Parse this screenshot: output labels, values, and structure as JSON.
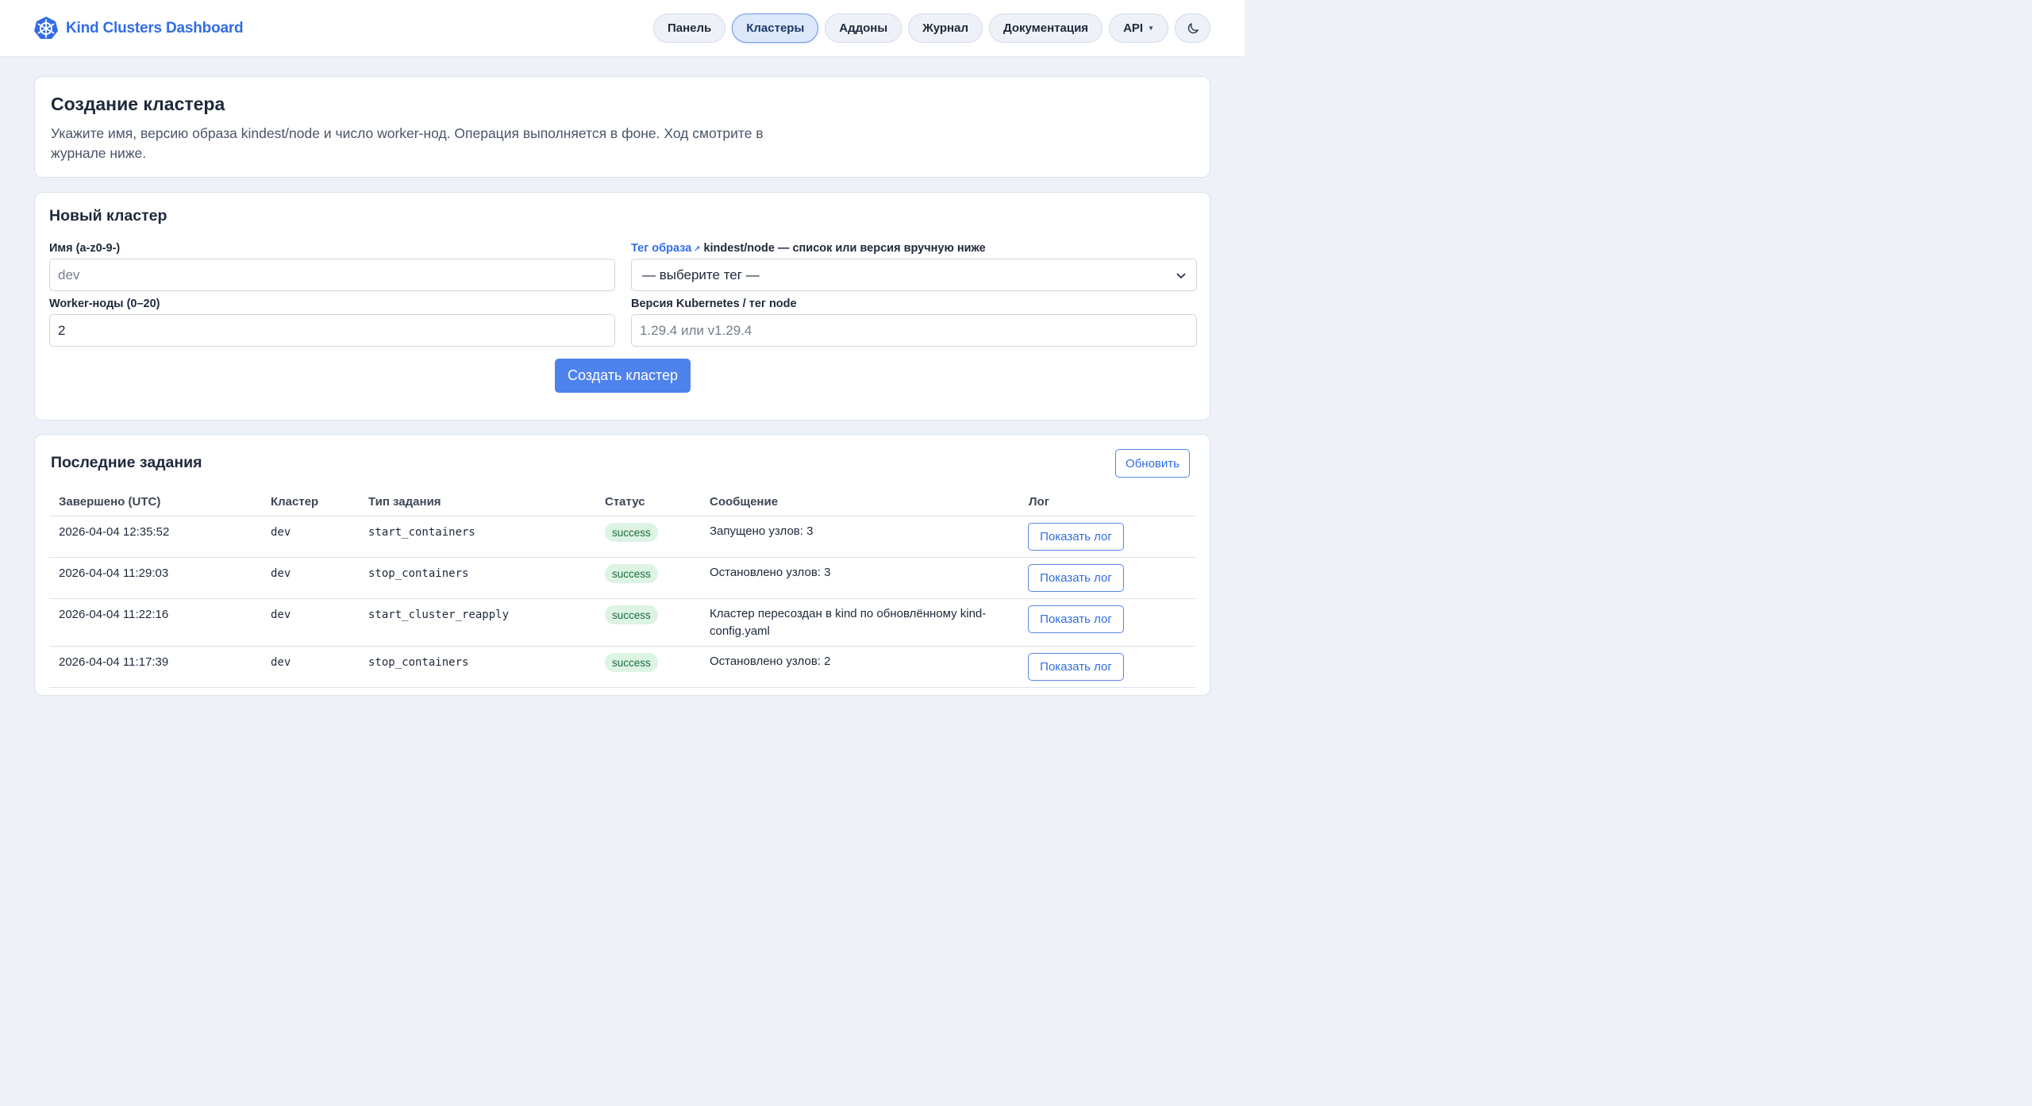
{
  "header": {
    "brand_title": "Kind Clusters Dashboard",
    "logo_icon": "kubernetes-helm-icon",
    "nav": [
      {
        "label": "Панель",
        "active": false
      },
      {
        "label": "Кластеры",
        "active": true
      },
      {
        "label": "Аддоны",
        "active": false
      },
      {
        "label": "Журнал",
        "active": false
      },
      {
        "label": "Документация",
        "active": false
      },
      {
        "label": "API",
        "active": false,
        "has_dropdown": true
      }
    ],
    "theme_toggle_icon": "moon-icon"
  },
  "intro": {
    "title": "Создание кластера",
    "description": "Укажите имя, версию образа kindest/node и число worker-нод. Операция выполняется в фоне. Ход смотрите в журнале ниже."
  },
  "form": {
    "title": "Новый кластер",
    "name_label": "Имя (a-z0-9-)",
    "name_placeholder": "dev",
    "workers_label": "Worker-ноды (0–20)",
    "workers_value": "2",
    "tag_link": "Тег образа",
    "tag_label_rest": " kindest/node — список или версия вручную ниже",
    "tag_select_value": "— выберите тег —",
    "version_label": "Версия Kubernetes / тег node",
    "version_placeholder": "1.29.4 или v1.29.4",
    "create_button": "Создать кластер"
  },
  "jobs": {
    "title": "Последние задания",
    "refresh_button": "Обновить",
    "columns": [
      "Завершено (UTC)",
      "Кластер",
      "Тип задания",
      "Статус",
      "Сообщение",
      "Лог"
    ],
    "rows": [
      {
        "finished": "2026-04-04 12:35:52",
        "cluster": "dev",
        "type": "start_containers",
        "status": "success",
        "message": "Запущено узлов: 3",
        "log_button": "Показать лог"
      },
      {
        "finished": "2026-04-04 11:29:03",
        "cluster": "dev",
        "type": "stop_containers",
        "status": "success",
        "message": "Остановлено узлов: 3",
        "log_button": "Показать лог"
      },
      {
        "finished": "2026-04-04 11:22:16",
        "cluster": "dev",
        "type": "start_cluster_reapply",
        "status": "success",
        "message": "Кластер пересоздан в kind по обновлённому kind-config.yaml",
        "log_button": "Показать лог"
      },
      {
        "finished": "2026-04-04 11:17:39",
        "cluster": "dev",
        "type": "stop_containers",
        "status": "success",
        "message": "Остановлено узлов: 2",
        "log_button": "Показать лог"
      }
    ]
  },
  "colors": {
    "accent": "#326ce5",
    "primary_button": "#4e82ec",
    "success_bg": "#ddf3e4",
    "success_text": "#1a6d3c",
    "page_bg": "#eef2f8"
  }
}
